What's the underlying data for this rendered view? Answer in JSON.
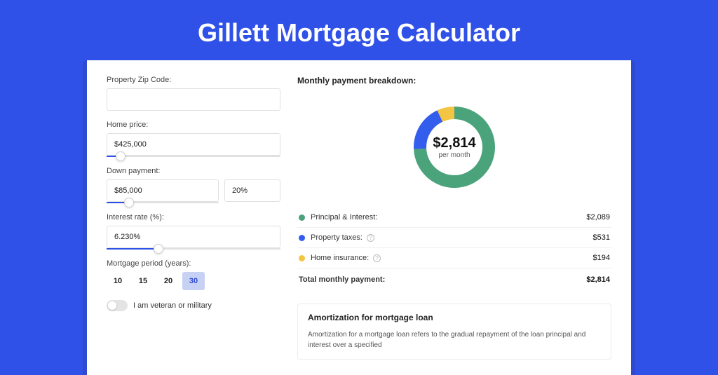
{
  "hero": {
    "title": "Gillett Mortgage Calculator"
  },
  "form": {
    "zip_label": "Property Zip Code:",
    "zip_value": "",
    "home_price_label": "Home price:",
    "home_price_value": "$425,000",
    "home_price_slider_pct": 8,
    "down_payment_label": "Down payment:",
    "down_payment_value": "$85,000",
    "down_payment_pct_value": "20%",
    "down_payment_slider_pct": 20,
    "interest_label": "Interest rate (%):",
    "interest_value": "6.230%",
    "interest_slider_pct": 30,
    "period_label": "Mortgage period (years):",
    "period_options": [
      "10",
      "15",
      "20",
      "30"
    ],
    "period_selected": "30",
    "veteran_label": "I am veteran or military"
  },
  "breakdown": {
    "title": "Monthly payment breakdown:",
    "center_amount": "$2,814",
    "center_sub": "per month",
    "items": [
      {
        "label": "Principal & Interest:",
        "value": "$2,089",
        "color": "#4aa37a",
        "info": false,
        "numeric": 2089
      },
      {
        "label": "Property taxes:",
        "value": "$531",
        "color": "#335ded",
        "info": true,
        "numeric": 531
      },
      {
        "label": "Home insurance:",
        "value": "$194",
        "color": "#f3c543",
        "info": true,
        "numeric": 194
      }
    ],
    "total_label": "Total monthly payment:",
    "total_value": "$2,814"
  },
  "amort": {
    "title": "Amortization for mortgage loan",
    "text": "Amortization for a mortgage loan refers to the gradual repayment of the loan principal and interest over a specified"
  },
  "chart_data": {
    "type": "pie",
    "title": "Monthly payment breakdown",
    "categories": [
      "Principal & Interest",
      "Property taxes",
      "Home insurance"
    ],
    "values": [
      2089,
      531,
      194
    ],
    "colors": [
      "#4aa37a",
      "#335ded",
      "#f3c543"
    ],
    "total": 2814,
    "unit": "USD/month"
  }
}
